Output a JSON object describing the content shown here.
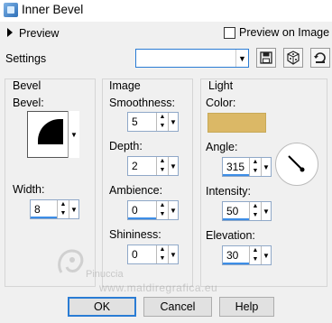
{
  "window": {
    "title": "Inner Bevel"
  },
  "preview": {
    "label": "Preview",
    "preview_on_image_label": "Preview on Image"
  },
  "settings": {
    "label": "Settings",
    "value": ""
  },
  "bevel_group": {
    "title": "Bevel",
    "bevel_label": "Bevel:",
    "width_label": "Width:",
    "width_value": "8"
  },
  "image_group": {
    "title": "Image",
    "smoothness_label": "Smoothness:",
    "smoothness_value": "5",
    "depth_label": "Depth:",
    "depth_value": "2",
    "ambience_label": "Ambience:",
    "ambience_value": "0",
    "shininess_label": "Shininess:",
    "shininess_value": "0"
  },
  "light_group": {
    "title": "Light",
    "color_label": "Color:",
    "color_value": "#dbb866",
    "angle_label": "Angle:",
    "angle_value": "315",
    "intensity_label": "Intensity:",
    "intensity_value": "50",
    "elevation_label": "Elevation:",
    "elevation_value": "30"
  },
  "buttons": {
    "ok": "OK",
    "cancel": "Cancel",
    "help": "Help"
  },
  "watermark": {
    "line1": "Pinuccia",
    "line2": "www.maldiregrafica.eu"
  }
}
